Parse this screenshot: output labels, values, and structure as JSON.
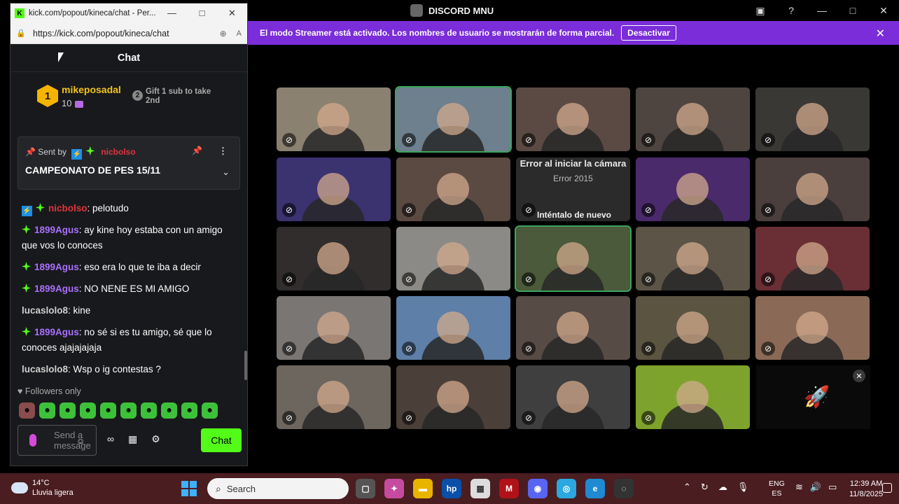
{
  "discord": {
    "title": "DISCORD MNU",
    "controls": [
      "▣",
      "?",
      "—",
      "□",
      "✕"
    ],
    "banner": {
      "text": "El modo Streamer está activado. Los nombres de usuario se mostrarán de forma parcial.",
      "button": "Desactivar"
    },
    "camera_error": {
      "title": "Error al iniciar la cámara",
      "code": "Error 2015",
      "retry": "Inténtalo de nuevo"
    },
    "tiles": [
      {
        "bg": "#8b8170",
        "active": false
      },
      {
        "bg": "#6e7f8e",
        "active": true
      },
      {
        "bg": "#5a4a43",
        "active": false
      },
      {
        "bg": "#4e4540",
        "active": false
      },
      {
        "bg": "#3a3835",
        "active": false
      },
      {
        "bg": "#3b3270",
        "active": false
      },
      {
        "bg": "#5b4a42",
        "active": false
      },
      {
        "bg": "error",
        "active": false
      },
      {
        "bg": "#4a2a6b",
        "active": false
      },
      {
        "bg": "#4a3f3d",
        "active": false
      },
      {
        "bg": "#302d2c",
        "active": false
      },
      {
        "bg": "#8c8a86",
        "active": false
      },
      {
        "bg": "#4a5a3a",
        "active": true
      },
      {
        "bg": "#5c5547",
        "active": false
      },
      {
        "bg": "#6a2f35",
        "active": false
      },
      {
        "bg": "#7a7673",
        "active": false
      },
      {
        "bg": "#5d7fa8",
        "active": false
      },
      {
        "bg": "#574b45",
        "active": false
      },
      {
        "bg": "#5a5440",
        "active": false
      },
      {
        "bg": "#8a6a56",
        "active": false
      },
      {
        "bg": "#6c665f",
        "active": false
      },
      {
        "bg": "#4b3f3a",
        "active": false
      },
      {
        "bg": "#3f3f3f",
        "active": false
      },
      {
        "bg": "#7ea32c",
        "active": false
      }
    ]
  },
  "popout": {
    "tab_title": "kick.com/popout/kineca/chat - Per...",
    "url": "https://kick.com/popout/kineca/chat",
    "window_controls": [
      "—",
      "□",
      "✕"
    ],
    "chat_header": "Chat",
    "leaderboard": {
      "rank": "1",
      "user": "mikeposadal",
      "count": "10",
      "rank2": "2",
      "gift_line1": "Gift 1 sub to take",
      "gift_line2": "2nd"
    },
    "pinned": {
      "sent_by": "Sent by",
      "nick": "nicbolso",
      "text": "CAMPEONATO DE PES 15/11"
    },
    "messages": [
      {
        "user": "nicbolso",
        "color": "red",
        "badges": "bolt+diamond",
        "text": ": pelotudo"
      },
      {
        "user": "1899Agus",
        "color": "purple",
        "badges": "diamond",
        "text": ": ay kine hoy estaba con un amigo que vos lo conoces"
      },
      {
        "user": "1899Agus",
        "color": "purple",
        "badges": "diamond",
        "text": ": eso era lo que te iba a decir"
      },
      {
        "user": "1899Agus",
        "color": "purple",
        "badges": "diamond",
        "text": ": NO NENE ES MI AMIGO"
      },
      {
        "user": "lucaslolo8",
        "color": "grey",
        "badges": "",
        "text": ": kine"
      },
      {
        "user": "1899Agus",
        "color": "purple",
        "badges": "diamond",
        "text": ": no sé si es tu amigo, sé que lo conoces ajajajajaja"
      },
      {
        "user": "lucaslolo8",
        "color": "grey",
        "badges": "",
        "text": ": Wsp o ig contestas ?"
      }
    ],
    "followers_only": "Followers only",
    "send_placeholder": "Send a message",
    "chat_button": "Chat"
  },
  "taskbar": {
    "temp": "14°C",
    "weather": "Lluvia ligera",
    "search": "Search",
    "lang1": "ENG",
    "lang2": "ES",
    "time": "12:39 AM",
    "date": "11/8/2025"
  }
}
